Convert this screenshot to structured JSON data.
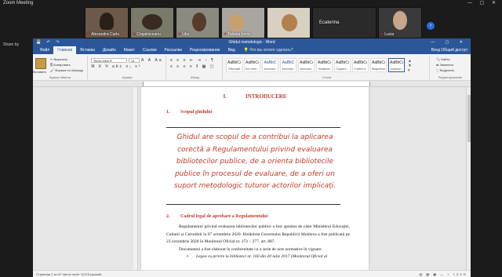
{
  "zoom": {
    "window_title": "Zoom Meeting",
    "share_label": "Share by",
    "participants": [
      {
        "name": "Alexandra Carlo",
        "muted": true,
        "kind": "video"
      },
      {
        "name": "Cogalniceanu",
        "muted": true,
        "kind": "video"
      },
      {
        "name": "Lilia",
        "muted": true,
        "kind": "video"
      },
      {
        "name": "Tatiana Ionici",
        "muted": true,
        "kind": "video"
      },
      {
        "name": "Ecaterina",
        "muted": false,
        "kind": "blank"
      },
      {
        "name": "Lucia",
        "muted": true,
        "kind": "video"
      }
    ]
  },
  "word": {
    "title": "Ghidul metodologic - Word",
    "tabs": [
      "Файл",
      "Главная",
      "Вставка",
      "Дизайн",
      "Макет",
      "Ссылки",
      "Рассылки",
      "Рецензирование",
      "Вид"
    ],
    "active_tab": 1,
    "search_placeholder": "Что вы хотите сделать?",
    "right_commands": "Вход  Общий доступ",
    "clipboard": {
      "paste": "Вставить",
      "cut": "Вырезать",
      "copy": "Копировать",
      "painter": "Формат по образцу",
      "label": "Буфер обмена"
    },
    "font": {
      "name": "Times New R",
      "size": "14",
      "label": "Шрифт",
      "format_row": "Ж К Ч abc x₂ x²",
      "color_row": "А А Аа"
    },
    "paragraph": {
      "label": "Абзац",
      "row1": "≡ ≡ ≡ ⇤ ⇥ ↕ ¶",
      "row2": "≡ ≡ ≡ ≡ ‖ ▦ ▢"
    },
    "styles": {
      "label": "Стили",
      "items": [
        {
          "preview": "AaBbCc",
          "name": "Обычный"
        },
        {
          "preview": "AaBbCc",
          "name": "Без инте..."
        },
        {
          "preview": "AaBbC",
          "name": "Заголово..."
        },
        {
          "preview": "AaBbC",
          "name": "Заголово..."
        },
        {
          "preview": "AaBbCc",
          "name": "Заголово..."
        },
        {
          "preview": "AaBbCc",
          "name": "Название"
        },
        {
          "preview": "AaBbCc",
          "name": "Подзаго..."
        },
        {
          "preview": "AaBbCc",
          "name": "Слабое в..."
        },
        {
          "preview": "AaBbCc",
          "name": "Выделение"
        },
        {
          "preview": "AaBbCc",
          "name": "Сильное..."
        }
      ]
    },
    "editing": {
      "find": "Найти",
      "replace": "Заменить",
      "select": "Выделить",
      "label": "Редактирование"
    },
    "statusbar": {
      "left": "Страница 2 из 47   Число слов: 12215   русский",
      "right": "▤ ▦ ▣  —  +  100%"
    }
  },
  "document": {
    "chapter_num": "I.",
    "chapter_title": "INTRODUCERE",
    "sec1_num": "1.",
    "sec1_title": "Scopul  ghidului",
    "quote": "Ghidul are scopul de a contribui la aplicarea corectă a Regulamentului privind evaluarea bibliotecilor publice, de a orienta bibliotecile publice în procesul de evaluare, de a oferi un suport metodologic tuturor actorilor implicați.",
    "sec2_num": "2.",
    "sec2_title": "Cadrul legal  de aprobare a Regulamentului",
    "para1": "Regulamentul privind evaluarea bibliotecilor publice a fost aprobat de către Ministerul Educației, Culturii și Cercetării la 07 octombrie 2020. Hotărârea Guvernului Republicii Moldova a fost publicată pe 23 octombrie 2020 în Monitorul Oficial nr. 272 – 277, art. 887.",
    "para2": "Documentul a fost elaborat în conformitate cu o serie de acte normative în vigoare:",
    "bullet": "Legea cu privire la biblioteci nr. 160 din 20 iulie 2017 (Monitorul Oficial al"
  }
}
